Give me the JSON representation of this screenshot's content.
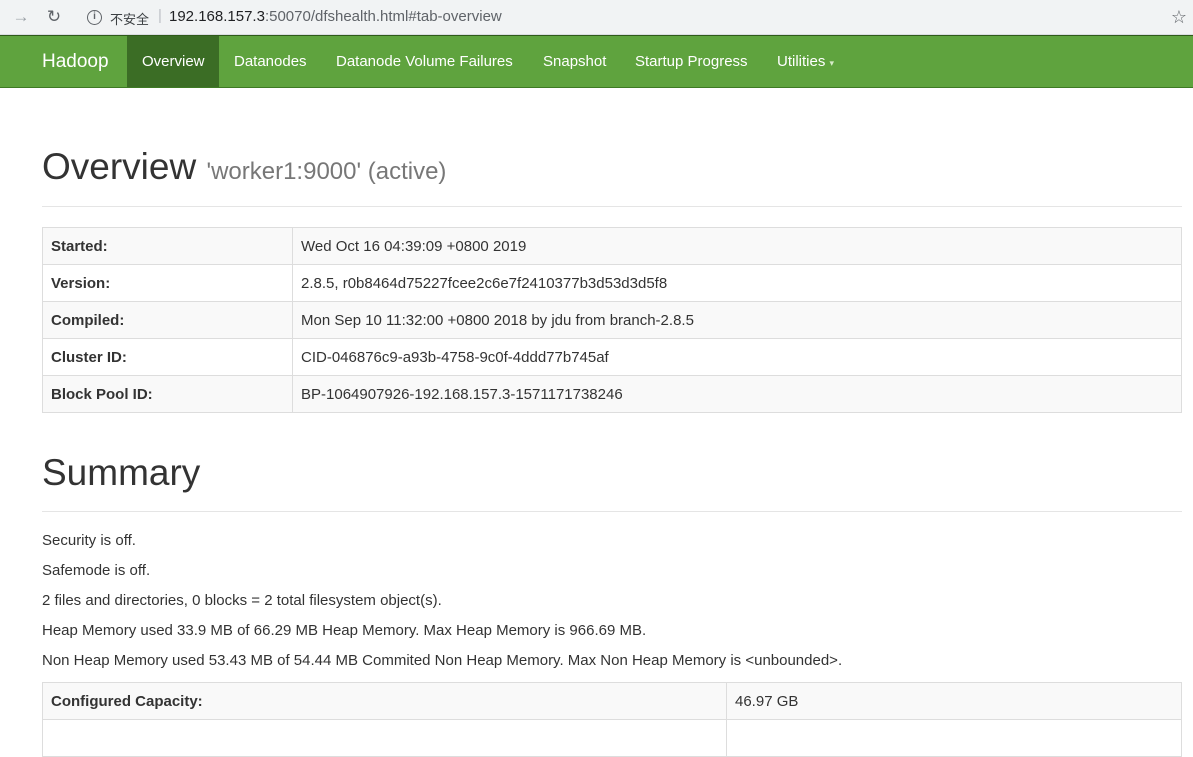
{
  "browser": {
    "insecure_label": "不安全",
    "url_host": "192.168.157.3",
    "url_rest": ":50070/dfshealth.html#tab-overview"
  },
  "navbar": {
    "brand": "Hadoop",
    "items": [
      {
        "label": "Overview"
      },
      {
        "label": "Datanodes"
      },
      {
        "label": "Datanode Volume Failures"
      },
      {
        "label": "Snapshot"
      },
      {
        "label": "Startup Progress"
      },
      {
        "label": "Utilities"
      }
    ]
  },
  "overview": {
    "title": "Overview",
    "subtitle": "'worker1:9000' (active)",
    "rows": [
      {
        "key": "Started:",
        "value": "Wed Oct 16 04:39:09 +0800 2019"
      },
      {
        "key": "Version:",
        "value": "2.8.5, r0b8464d75227fcee2c6e7f2410377b3d53d3d5f8"
      },
      {
        "key": "Compiled:",
        "value": "Mon Sep 10 11:32:00 +0800 2018 by jdu from branch-2.8.5"
      },
      {
        "key": "Cluster ID:",
        "value": "CID-046876c9-a93b-4758-9c0f-4ddd77b745af"
      },
      {
        "key": "Block Pool ID:",
        "value": "BP-1064907926-192.168.157.3-1571171738246"
      }
    ]
  },
  "summary": {
    "title": "Summary",
    "lines": [
      "Security is off.",
      "Safemode is off.",
      "2 files and directories, 0 blocks = 2 total filesystem object(s).",
      "Heap Memory used 33.9 MB of 66.29 MB Heap Memory. Max Heap Memory is 966.69 MB.",
      "Non Heap Memory used 53.43 MB of 54.44 MB Commited Non Heap Memory. Max Non Heap Memory is <unbounded>."
    ],
    "rows": [
      {
        "key": "Configured Capacity:",
        "value": "46.97 GB"
      },
      {
        "key": "",
        "value": ""
      }
    ]
  }
}
